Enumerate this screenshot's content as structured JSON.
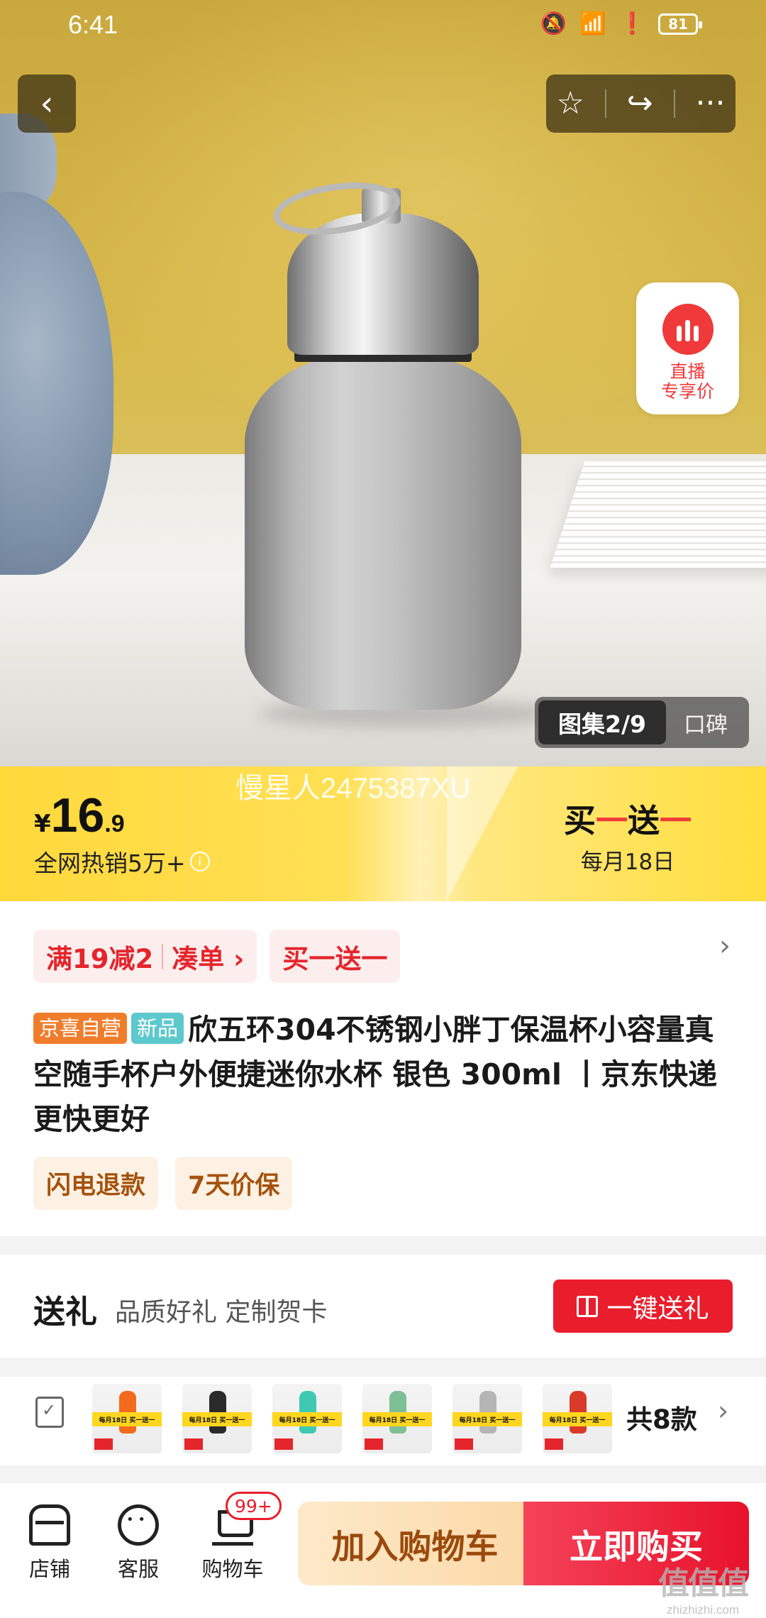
{
  "status_bar": {
    "time": "6:41",
    "battery": "81"
  },
  "top_actions": {
    "back": "‹",
    "favorite": "☆",
    "share": "↪",
    "more": "···"
  },
  "live_badge": {
    "line1": "直播",
    "line2": "专享价"
  },
  "gallery": {
    "active_tab": "图集2/9",
    "other_tab": "口碑"
  },
  "price_bar": {
    "watermark": "慢星人2475387XU",
    "currency": "¥",
    "price_int": "16",
    "price_dec": ".9",
    "sales": "全网热销5万+",
    "promo_part1": "买",
    "promo_dash1": "一",
    "promo_part2": "送",
    "promo_dash2": "一",
    "promo_date": "每月18日"
  },
  "promos": {
    "chip1_a": "满19减2",
    "chip1_b": "凑单 ›",
    "chip2": "买一送一",
    "more": "›"
  },
  "product": {
    "tag1": "京喜自营",
    "tag2": "新品",
    "title": "欣五环304不锈钢小胖丁保温杯小容量真空随手杯户外便捷迷你水杯 银色 300ml 丨京东快递 更快更好"
  },
  "services": [
    "闪电退款",
    "7天价保"
  ],
  "gift": {
    "label": "送礼",
    "subtitle": "品质好礼 定制贺卡",
    "button": "一键送礼"
  },
  "variants": {
    "count": "共8款",
    "chevron": "›",
    "thumb_text": "每月18日 买一送一",
    "colors": [
      "#f26a1b",
      "#2b2b2b",
      "#3fc9b2",
      "#7fbf96",
      "#b5b5b5",
      "#d93a2a"
    ]
  },
  "bottom_nav": {
    "store": "店铺",
    "service": "客服",
    "cart": "购物车",
    "cart_badge": "99+",
    "add_to_cart": "加入购物车",
    "buy_now": "立即购买"
  },
  "site_watermark": {
    "logo": "值值值",
    "domain": "zhizhizhi.com"
  }
}
